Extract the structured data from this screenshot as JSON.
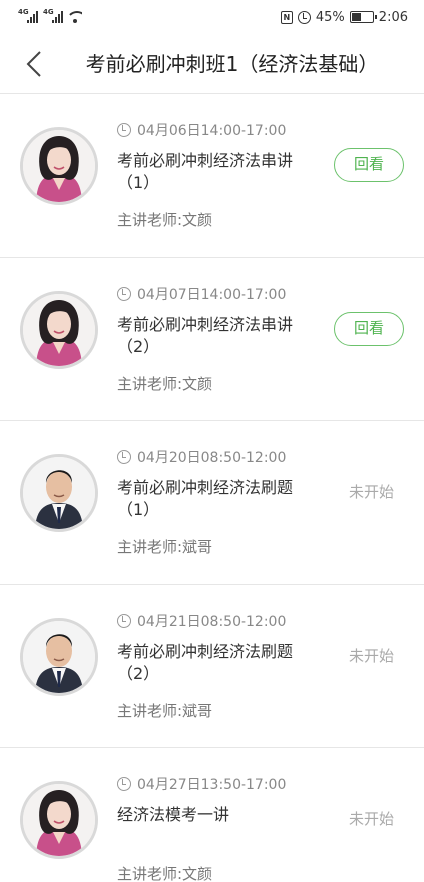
{
  "status_bar": {
    "net1": "4G",
    "net2": "4G",
    "battery": "45%",
    "time": "2:06"
  },
  "header": {
    "title": "考前必刷冲刺班1（经济法基础）"
  },
  "sessions": [
    {
      "time": "04月06日14:00-17:00",
      "title": "考前必刷冲刺经济法串讲（1）",
      "teacher": "主讲老师:文颜",
      "action": "回看",
      "status": ""
    },
    {
      "time": "04月07日14:00-17:00",
      "title": "考前必刷冲刺经济法串讲（2）",
      "teacher": "主讲老师:文颜",
      "action": "回看",
      "status": ""
    },
    {
      "time": "04月20日08:50-12:00",
      "title": "考前必刷冲刺经济法刷题（1）",
      "teacher": "主讲老师:斌哥",
      "action": "",
      "status": "未开始"
    },
    {
      "time": "04月21日08:50-12:00",
      "title": "考前必刷冲刺经济法刷题（2）",
      "teacher": "主讲老师:斌哥",
      "action": "",
      "status": "未开始"
    },
    {
      "time": "04月27日13:50-17:00",
      "title": "经济法模考一讲",
      "teacher": "主讲老师:文颜",
      "action": "",
      "status": "未开始"
    }
  ],
  "colors": {
    "accent_green": "#4fb34f",
    "border_green": "#6cc26c",
    "muted": "#aaaaaa"
  },
  "icons": {
    "back": "chevron-left-icon",
    "clock": "clock-icon"
  }
}
